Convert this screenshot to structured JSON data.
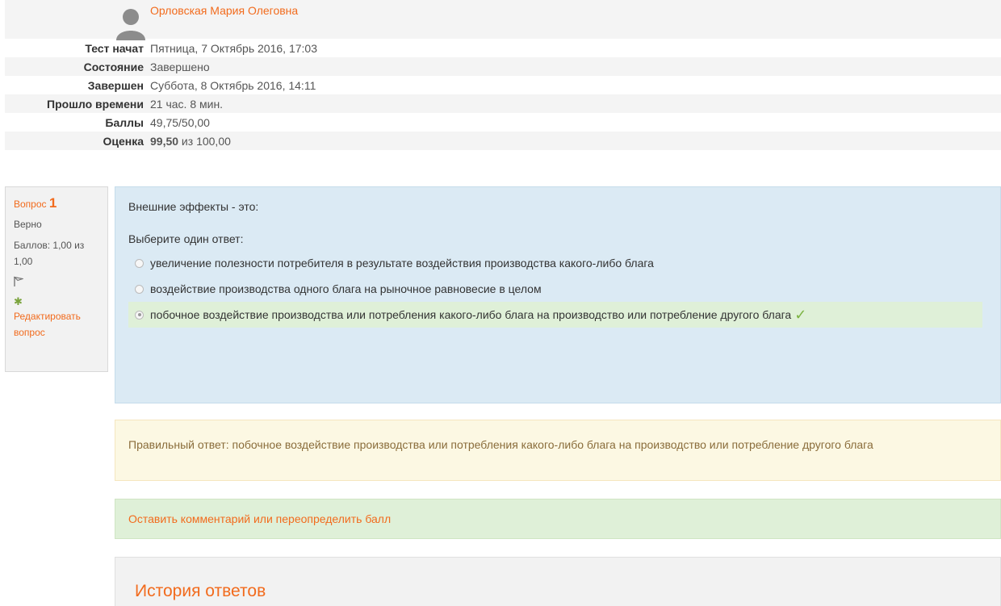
{
  "attempt": {
    "user_name": "Орловская Мария Олеговна",
    "rows": [
      {
        "label": "Тест начат",
        "value": "Пятница, 7 Октябрь 2016, 17:03"
      },
      {
        "label": "Состояние",
        "value": "Завершено"
      },
      {
        "label": "Завершен",
        "value": "Суббота, 8 Октябрь 2016, 14:11"
      },
      {
        "label": "Прошло времени",
        "value": "21 час. 8 мин."
      },
      {
        "label": "Баллы",
        "value": "49,75/50,00"
      }
    ],
    "grade_label": "Оценка",
    "grade_value": "99,50",
    "grade_suffix": " из 100,00"
  },
  "question_info": {
    "title": "Вопрос",
    "number": "1",
    "state": "Верно",
    "marks": "Баллов: 1,00 из 1,00",
    "edit_link": "Редактировать вопрос",
    "icons": [
      "flag-icon",
      "gear-icon"
    ]
  },
  "question": {
    "text": "Внешние эффекты - это:",
    "prompt": "Выберите один ответ:",
    "answers": [
      {
        "text": "увеличение полезности потребителя в результате воздействия производства какого-либо блага",
        "checked": false
      },
      {
        "text": "воздействие производства одного блага на рыночное равновесие в целом",
        "checked": false
      },
      {
        "text": "побочное воздействие производства или потребления какого-либо блага на производство или потребление другого блага",
        "checked": true
      }
    ]
  },
  "feedback": {
    "right_answer": "Правильный ответ: побочное воздействие производства или потребления какого-либо блага на производство или потребление другого блага"
  },
  "comment_link": "Оставить комментарий или переопределить балл",
  "history": {
    "title": "История ответов"
  },
  "colors": {
    "accent": "#f26b1d",
    "formulation_bg": "#dbeaf4",
    "outcome_bg": "#fcf8e3",
    "comment_bg": "#dff0d8",
    "correct_check": "#7cb342"
  }
}
